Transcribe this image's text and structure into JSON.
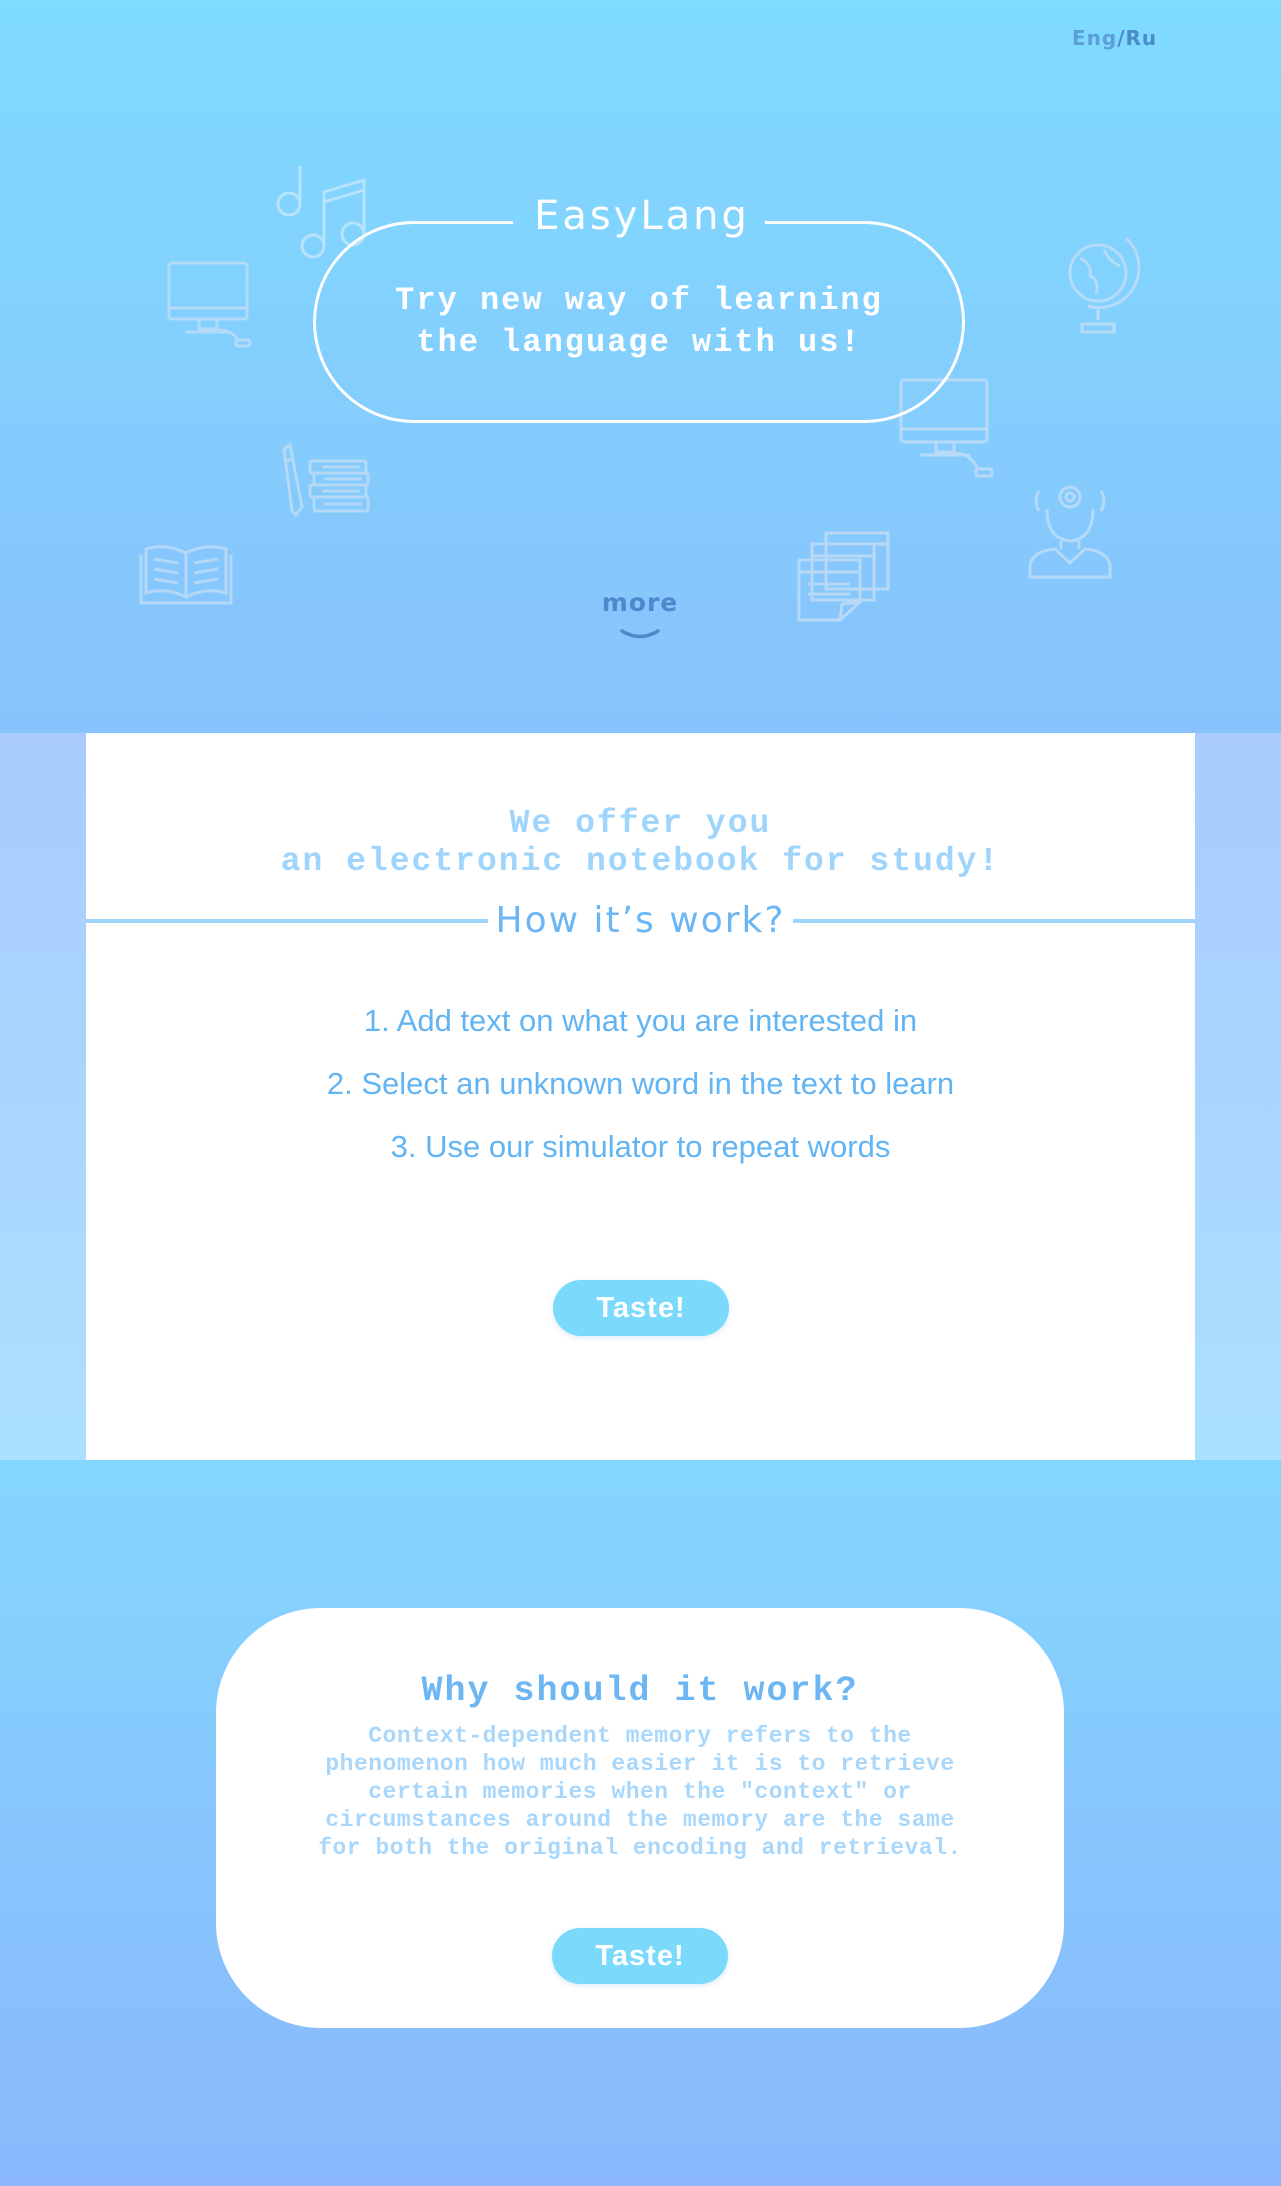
{
  "header": {
    "lang_en": "Eng",
    "lang_sep": "/",
    "lang_ru": "Ru"
  },
  "hero": {
    "logo": "EasyLang",
    "tagline_line1": "Try new way of learning",
    "tagline_line2": "the language with us!",
    "more_label": "more",
    "decor_icons": [
      "music-notes-icon",
      "computer-monitor-icon",
      "globe-icon",
      "pen-and-books-icon",
      "computer-monitor-icon",
      "person-thinking-icon",
      "open-book-icon",
      "documents-icon",
      "chevron-down-icon"
    ]
  },
  "offer": {
    "line1": "We offer you",
    "line2": "an electronic notebook for study!",
    "how_title": "How it’s work?",
    "steps": [
      "1. Add text on what you are interested in",
      "2. Select an unknown word in the text to learn",
      "3. Use our simulator to repeat words"
    ],
    "button_label": "Taste!"
  },
  "why": {
    "title": "Why should it work?",
    "text": "Context-dependent memory refers to the phenomenon how much easier it is to retrieve certain memories when the \"context\" or circumstances around the memory are the same for both the original encoding and retrieval.",
    "button_label": "Taste!"
  },
  "colors": {
    "hero_top": "#7fdbff",
    "hero_bottom": "#88c2fc",
    "accent_text": "#62b4f3",
    "button_bg": "#7bdafb",
    "muted_text": "#a9d7fb"
  }
}
